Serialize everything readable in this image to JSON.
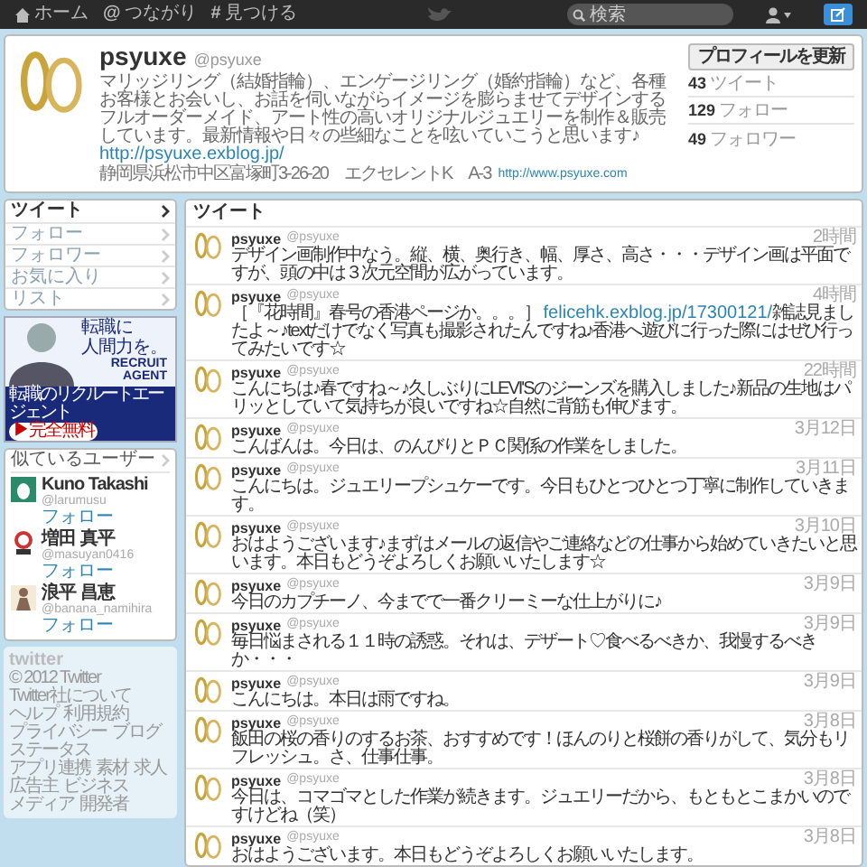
{
  "top_bar": {
    "nav": [
      {
        "kind": "home",
        "label": "ホーム"
      },
      {
        "kind": "glyph",
        "glyph": "@",
        "label": "つながり"
      },
      {
        "kind": "glyph",
        "glyph": "#",
        "label": "見つける"
      }
    ],
    "search": {
      "placeholder": "検索"
    }
  },
  "profile": {
    "name": "psyuxe",
    "handle": "@psyuxe",
    "bio": [
      {
        "kind": "text",
        "text": "マリッジリング（結婚指輪）、エンゲージリング（婚約指輪）など、各種お客様とお会いし、お話を伺いながらイメージを膨らませてデザインするフルオーダーメイド、アート性の高いオリジナルジュエリーを制作＆販売しています。最新情報や日々の些細なことを呟いていこうと思います♪ "
      },
      {
        "kind": "link",
        "text": "http://psyuxe.exblog.jp/"
      }
    ],
    "location": "静岡県浜松市中区富塚町3-26-20　エクセレントK　A-3",
    "url": "http://www.psyuxe.com",
    "edit_button": "プロフィールを更新",
    "stats": [
      {
        "count": "43",
        "label": "ツイート"
      },
      {
        "count": "129",
        "label": "フォロー"
      },
      {
        "count": "49",
        "label": "フォロワー"
      }
    ]
  },
  "sidebar": {
    "nav": [
      {
        "label": "ツイート",
        "selected": true
      },
      {
        "label": "フォロー",
        "selected": false
      },
      {
        "label": "フォロワー",
        "selected": false
      },
      {
        "label": "お気に入り",
        "selected": false
      },
      {
        "label": "リスト",
        "selected": false
      }
    ],
    "ad": {
      "headline": [
        "転職に",
        "人間力を。"
      ],
      "brand": [
        "RECRUIT",
        "AGENT"
      ],
      "caption": "転職のリクルートエージェント",
      "badge": "▶完全無料"
    },
    "similar_users": {
      "title": "似ているユーザー",
      "users": [
        {
          "kind": "egg",
          "name": "Kuno Takashi",
          "handle": "@larumusu",
          "action": "フォロー"
        },
        {
          "kind": "logo",
          "name": "増田 真平",
          "handle": "@masuyan0416",
          "action": "フォロー"
        },
        {
          "kind": "figure",
          "name": "浪平 昌恵",
          "handle": "@banana_namihira",
          "action": "フォロー"
        }
      ]
    },
    "footer": {
      "logo": "twitter",
      "links": [
        "© 2012 Twitter",
        "Twitter社について",
        "ヘルプ",
        "利用規約",
        "プライバシー",
        "ブログ",
        "ステータス",
        "アプリ連携",
        "素材",
        "求人",
        "広告主",
        "ビジネス",
        "メディア",
        "開発者"
      ]
    }
  },
  "timeline": {
    "title": "ツイート",
    "tweets": [
      {
        "name": "psyuxe",
        "handle": "@psyuxe",
        "time": "2時間",
        "segments": [
          {
            "kind": "text",
            "text": "デザイン画制作中なう。縦、横、奥行き、幅、厚さ、高さ・・・デザイン画は平面ですが、頭の中は３次元空間が広がっています。"
          }
        ]
      },
      {
        "name": "psyuxe",
        "handle": "@psyuxe",
        "time": "4時間",
        "segments": [
          {
            "kind": "text",
            "text": "［『花時間』春号の香港ページか。。。］ "
          },
          {
            "kind": "link",
            "text": "felicehk.exblog.jp/17300121/"
          },
          {
            "kind": "text",
            "text": "雑誌見ましたよ～♪textだけでなく写真も撮影されたんですね♪香港へ遊びに行った際にはぜひ行ってみたいです☆"
          }
        ]
      },
      {
        "name": "psyuxe",
        "handle": "@psyuxe",
        "time": "22時間",
        "segments": [
          {
            "kind": "text",
            "text": "こんにちは♪春ですね～♪久しぶりにLEVI'Sのジーンズを購入しました♪新品の生地はパリッとしていて気持ちが良いですね☆自然に背筋も伸びます。"
          }
        ]
      },
      {
        "name": "psyuxe",
        "handle": "@psyuxe",
        "time": "3月12日",
        "segments": [
          {
            "kind": "text",
            "text": "こんばんは。今日は、のんびりとＰＣ関係の作業をしました。"
          }
        ]
      },
      {
        "name": "psyuxe",
        "handle": "@psyuxe",
        "time": "3月11日",
        "segments": [
          {
            "kind": "text",
            "text": "こんにちは。ジュエリープシュケーです。今日もひとつひとつ丁寧に制作していきます。"
          }
        ]
      },
      {
        "name": "psyuxe",
        "handle": "@psyuxe",
        "time": "3月10日",
        "segments": [
          {
            "kind": "text",
            "text": "おはようございます♪まずはメールの返信やご連絡などの仕事から始めていきたいと思います。本日もどうぞよろしくお願いいたします☆"
          }
        ]
      },
      {
        "name": "psyuxe",
        "handle": "@psyuxe",
        "time": "3月9日",
        "segments": [
          {
            "kind": "text",
            "text": "今日のカプチーノ、今までで一番クリーミーな仕上がりに♪"
          }
        ]
      },
      {
        "name": "psyuxe",
        "handle": "@psyuxe",
        "time": "3月9日",
        "segments": [
          {
            "kind": "text",
            "text": "毎日悩まされる１１時の誘惑。それは、デザート♡食べるべきか、我慢するべきか・・・"
          }
        ]
      },
      {
        "name": "psyuxe",
        "handle": "@psyuxe",
        "time": "3月9日",
        "segments": [
          {
            "kind": "text",
            "text": "こんにちは。本日は雨ですね。"
          }
        ]
      },
      {
        "name": "psyuxe",
        "handle": "@psyuxe",
        "time": "3月8日",
        "segments": [
          {
            "kind": "text",
            "text": "飯田の桜の香りのするお茶、おすすめです！ほんのりと桜餅の香りがして、気分もリフレッシュ。さ、仕事仕事。"
          }
        ]
      },
      {
        "name": "psyuxe",
        "handle": "@psyuxe",
        "time": "3月8日",
        "segments": [
          {
            "kind": "text",
            "text": "今日は、コマゴマとした作業が続きます。ジュエリーだから、もともとこまかいのですけどね（笑）"
          }
        ]
      },
      {
        "name": "psyuxe",
        "handle": "@psyuxe",
        "time": "3月8日",
        "segments": [
          {
            "kind": "text",
            "text": "おはようございます。本日もどうぞよろしくお願いいたします。"
          }
        ]
      }
    ]
  }
}
